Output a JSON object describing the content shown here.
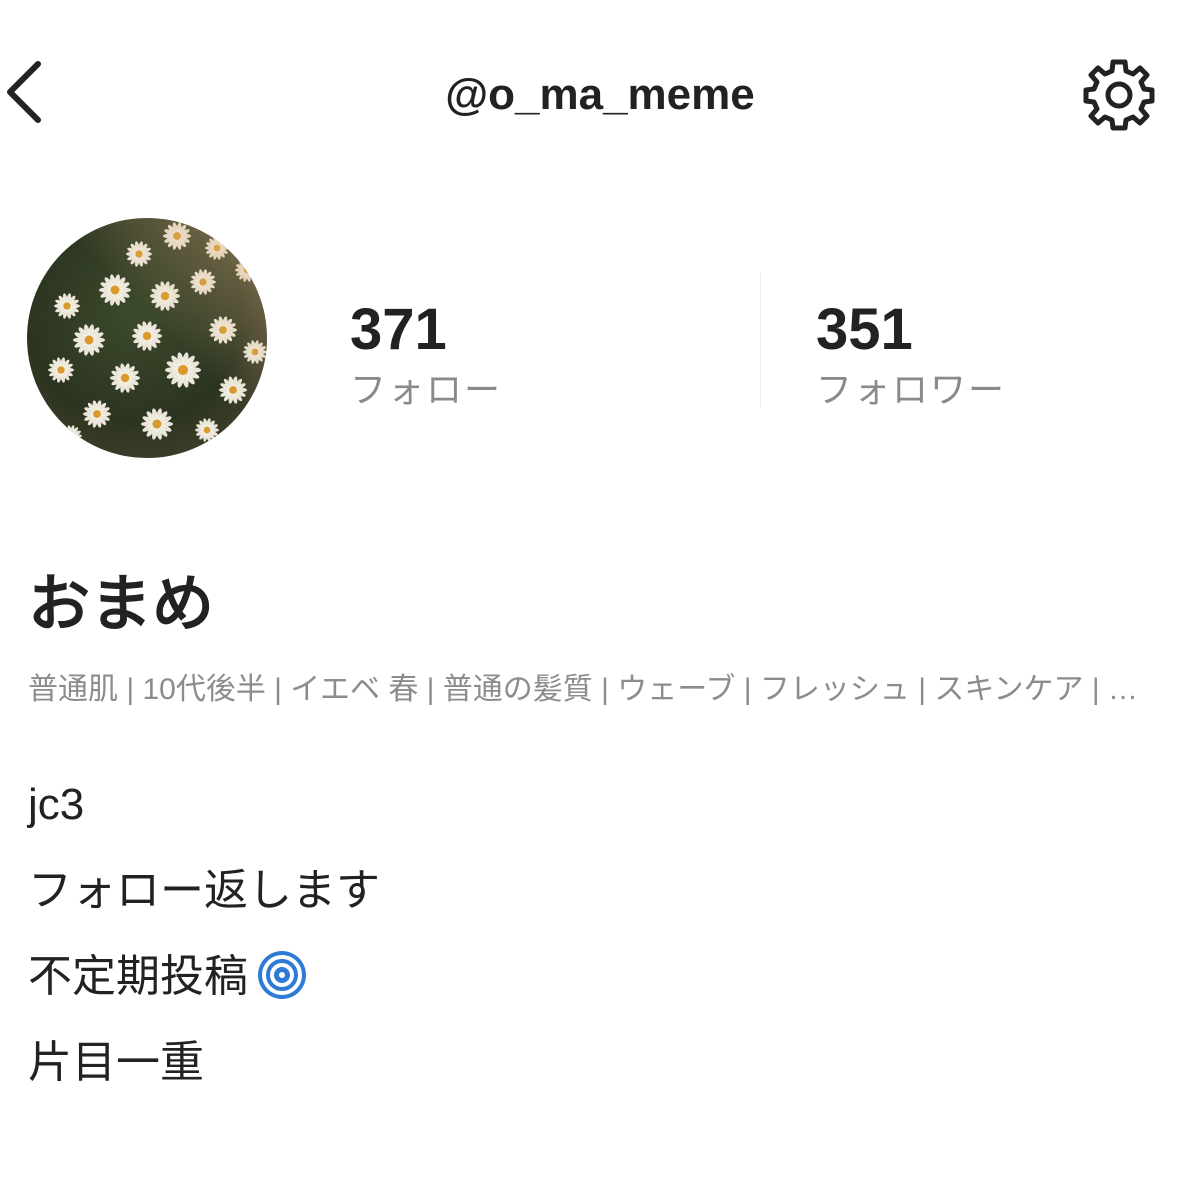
{
  "header": {
    "username": "@o_ma_meme",
    "back_icon": "chevron-left-icon",
    "settings_icon": "gear-icon"
  },
  "profile": {
    "avatar": "daisy-field-photo",
    "following": {
      "count": "371",
      "label": "フォロー"
    },
    "followers": {
      "count": "351",
      "label": "フォロワー"
    },
    "display_name": "おまめ",
    "tags": "普通肌 | 10代後半 | イエベ 春 | 普通の髪質 | ウェーブ | フレッシュ | スキンケア | メイク"
  },
  "bio": {
    "lines": [
      "jc3",
      "フォロー返します",
      "不定期投稿",
      "片目一重"
    ],
    "emoji": "cyclone"
  },
  "colors": {
    "text": "#222222",
    "muted": "#8a8a8a",
    "divider": "#eeeeee",
    "cyclone": "#2e7bd6"
  }
}
